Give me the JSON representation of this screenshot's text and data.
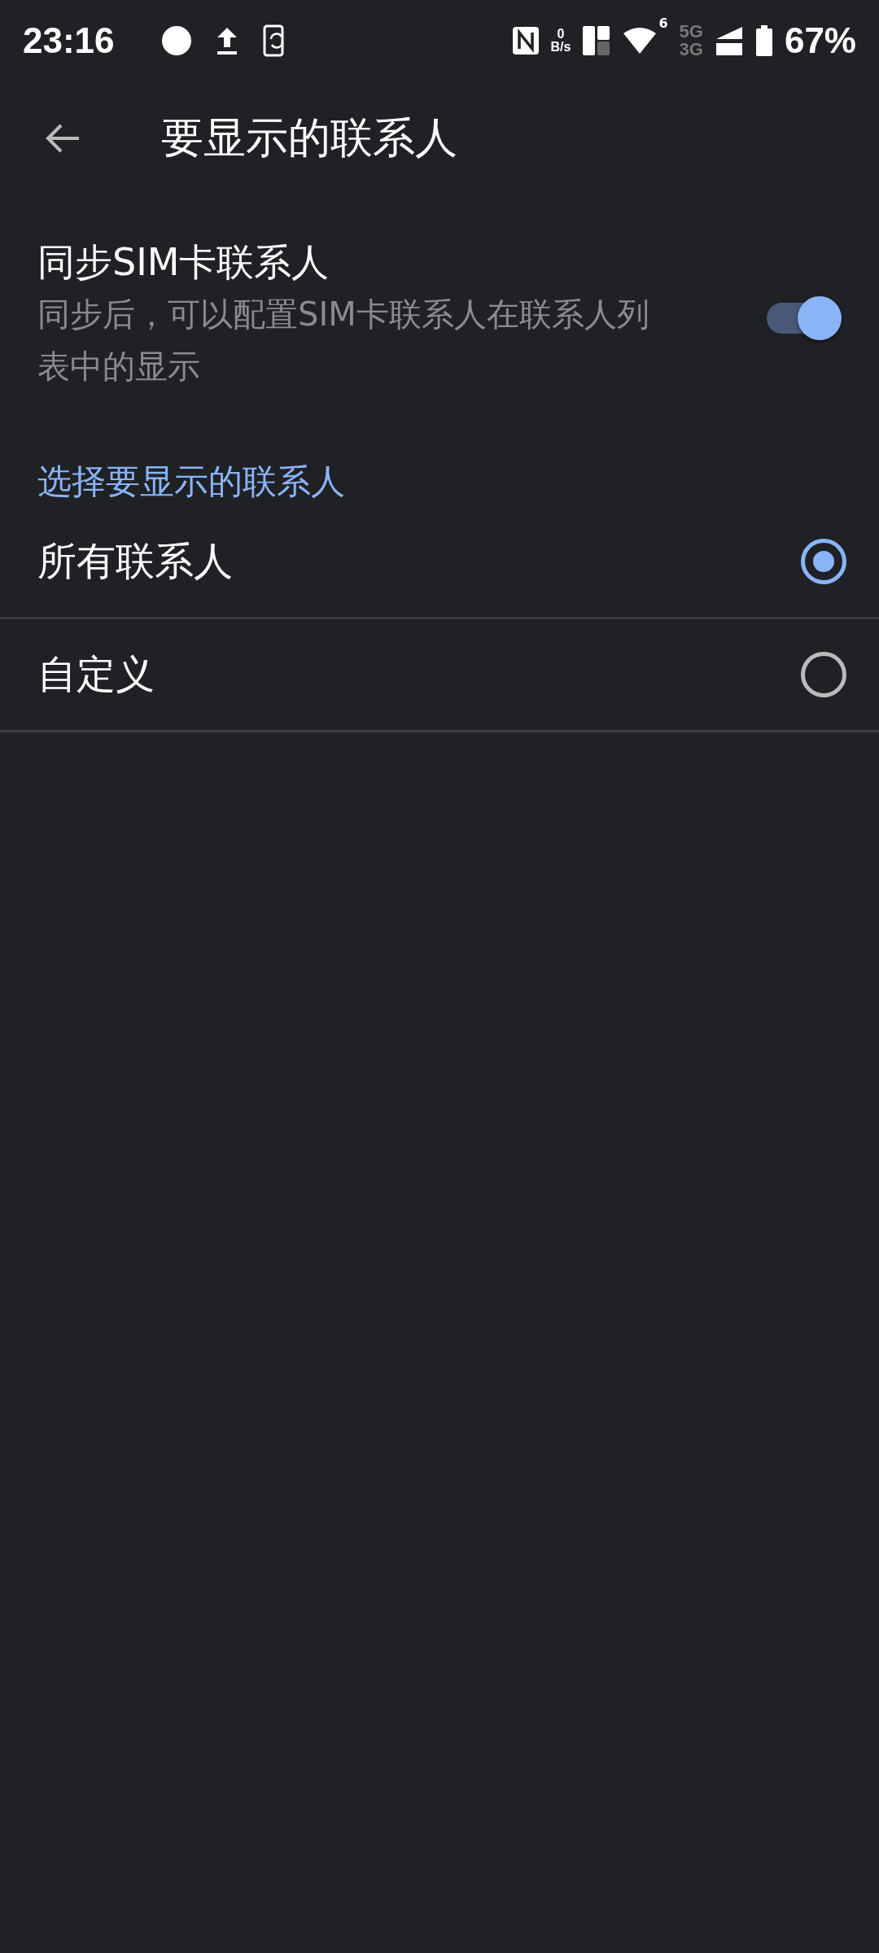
{
  "status_bar": {
    "time": "23:16",
    "net_speed_value": "0",
    "net_speed_unit": "B/s",
    "wifi_badge": "6",
    "network_top": "5G",
    "network_bottom": "3G",
    "battery": "67%"
  },
  "toolbar": {
    "title": "要显示的联系人"
  },
  "sync": {
    "title": "同步SIM卡联系人",
    "subtitle": "同步后，可以配置SIM卡联系人在联系人列表中的显示",
    "on": true
  },
  "section": {
    "header": "选择要显示的联系人"
  },
  "options": [
    {
      "label": "所有联系人",
      "selected": true
    },
    {
      "label": "自定义",
      "selected": false
    }
  ]
}
